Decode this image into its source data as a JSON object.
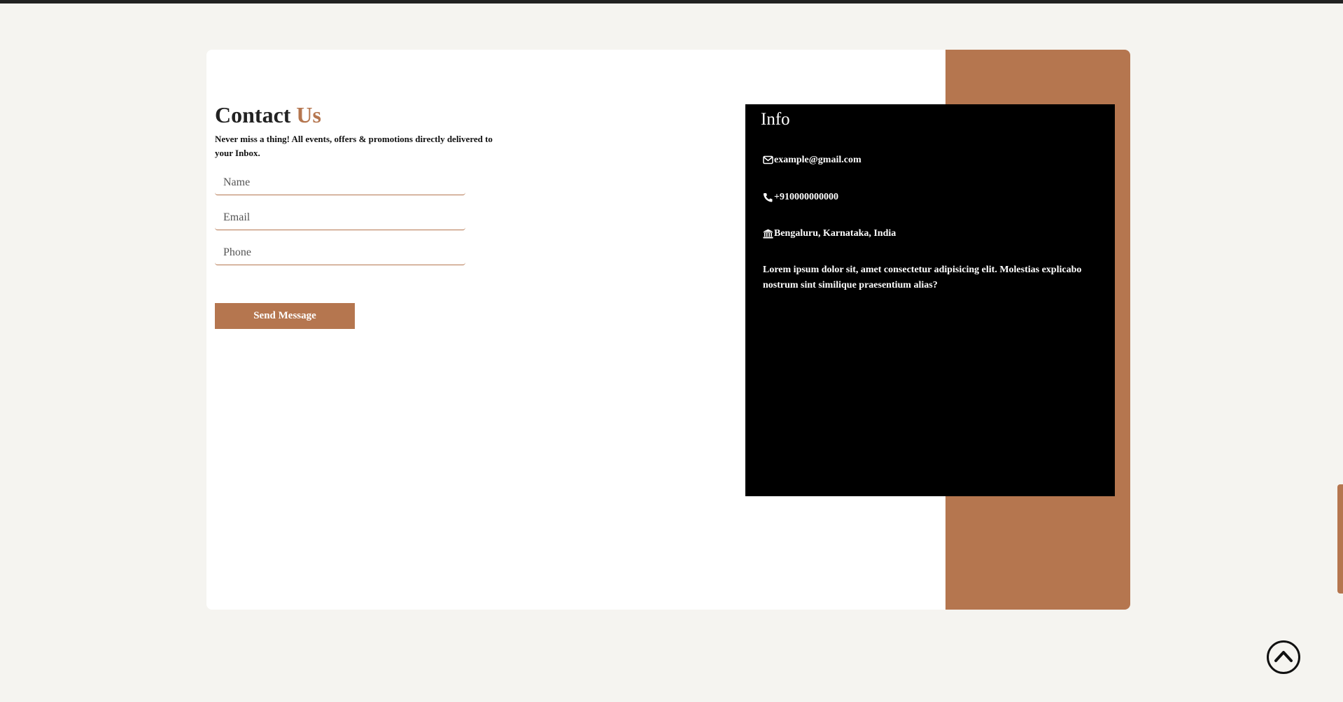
{
  "contact": {
    "title_main": "Contact",
    "title_accent": "Us",
    "subtitle": "Never miss a thing! All events, offers & promotions directly delivered to your Inbox.",
    "fields": {
      "name_placeholder": "Name",
      "email_placeholder": "Email",
      "phone_placeholder": "Phone"
    },
    "send_label": "Send Message"
  },
  "info": {
    "title": "Info",
    "email": "example@gmail.com",
    "phone": "+910000000000",
    "address": "Bengaluru, Karnataka, India",
    "description": "Lorem ipsum dolor sit, amet consectetur adipisicing elit. Molestias explicabo nostrum sint similique praesentium alias?"
  },
  "icons": {
    "email": "envelope-icon",
    "phone": "phone-icon",
    "address": "bank-building-icon",
    "scroll_top": "chevron-up-circle-icon"
  },
  "colors": {
    "accent": "#b5764f",
    "background": "#f5f4f0",
    "card": "#ffffff",
    "info_panel": "#000000",
    "text_dark": "#222222"
  }
}
